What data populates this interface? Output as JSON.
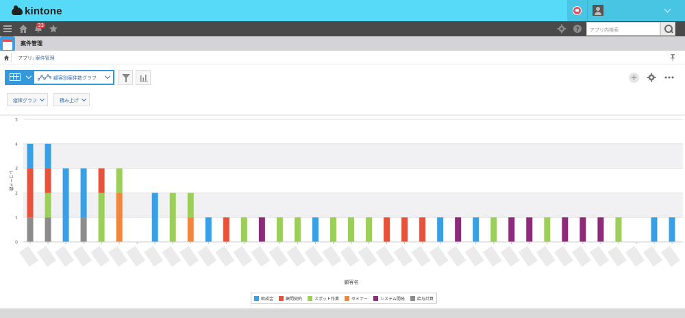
{
  "header": {
    "logo_text": "kintone",
    "notifications_count": "33",
    "search_placeholder": "アプリ内検索"
  },
  "app": {
    "title": "案件管理",
    "breadcrumb_prefix": "アプリ:",
    "breadcrumb_app": "案件管理"
  },
  "view": {
    "name": "顧客別案件数グラフ",
    "chart_type_label": "縦棒グラフ",
    "stack_label": "積み上げ"
  },
  "colors": {
    "topbar": "#56daf7",
    "navbar": "#4a4a4a",
    "accent": "#3498db"
  },
  "chart_data": {
    "type": "bar",
    "stacked": true,
    "ylabel": "レコード数",
    "xlabel": "顧客名",
    "ylim": [
      0,
      5
    ],
    "yticks": [
      "0",
      "1",
      "2",
      "3",
      "4",
      "5"
    ],
    "grid": true,
    "legend_position": "bottom",
    "series": [
      {
        "name": "助成金",
        "color": "#3aa0e6",
        "values": [
          1,
          1,
          3,
          2,
          0,
          0,
          0,
          2,
          0,
          0,
          1,
          0,
          0,
          0,
          0,
          0,
          1,
          0,
          0,
          0,
          0,
          0,
          0,
          1,
          0,
          1,
          0,
          0,
          0,
          0,
          0,
          0,
          0,
          0,
          0,
          1,
          1
        ]
      },
      {
        "name": "顧問契約",
        "color": "#e5533d",
        "values": [
          2,
          1,
          0,
          0,
          1,
          0,
          0,
          0,
          0,
          0,
          0,
          1,
          0,
          0,
          0,
          0,
          0,
          0,
          0,
          0,
          1,
          1,
          1,
          0,
          0,
          0,
          0,
          0,
          0,
          0,
          0,
          0,
          0,
          0,
          0,
          0,
          0
        ]
      },
      {
        "name": "スポット作業",
        "color": "#9ccf5a",
        "values": [
          0,
          1,
          0,
          0,
          2,
          1,
          0,
          0,
          2,
          1,
          0,
          0,
          1,
          0,
          1,
          1,
          0,
          1,
          1,
          1,
          0,
          0,
          0,
          0,
          0,
          0,
          1,
          0,
          0,
          1,
          0,
          0,
          0,
          1,
          0,
          0,
          0
        ]
      },
      {
        "name": "セミナー",
        "color": "#f0873c",
        "values": [
          0,
          0,
          0,
          0,
          0,
          2,
          0,
          0,
          0,
          1,
          0,
          0,
          0,
          0,
          0,
          0,
          0,
          0,
          0,
          0,
          0,
          0,
          0,
          0,
          0,
          0,
          0,
          0,
          0,
          0,
          0,
          0,
          0,
          0,
          0,
          0,
          0
        ]
      },
      {
        "name": "システム開発",
        "color": "#8e2a7a",
        "values": [
          0,
          0,
          0,
          0,
          0,
          0,
          0,
          0,
          0,
          0,
          0,
          0,
          0,
          1,
          0,
          0,
          0,
          0,
          0,
          0,
          0,
          0,
          0,
          0,
          1,
          0,
          0,
          1,
          1,
          0,
          1,
          1,
          1,
          0,
          0,
          0,
          0
        ]
      },
      {
        "name": "給与計算",
        "color": "#8c8c8c",
        "values": [
          1,
          1,
          0,
          1,
          0,
          0,
          0,
          0,
          0,
          0,
          0,
          0,
          0,
          0,
          0,
          0,
          0,
          0,
          0,
          0,
          0,
          0,
          0,
          0,
          0,
          0,
          0,
          0,
          0,
          0,
          0,
          0,
          0,
          0,
          0,
          0,
          0
        ]
      }
    ]
  }
}
